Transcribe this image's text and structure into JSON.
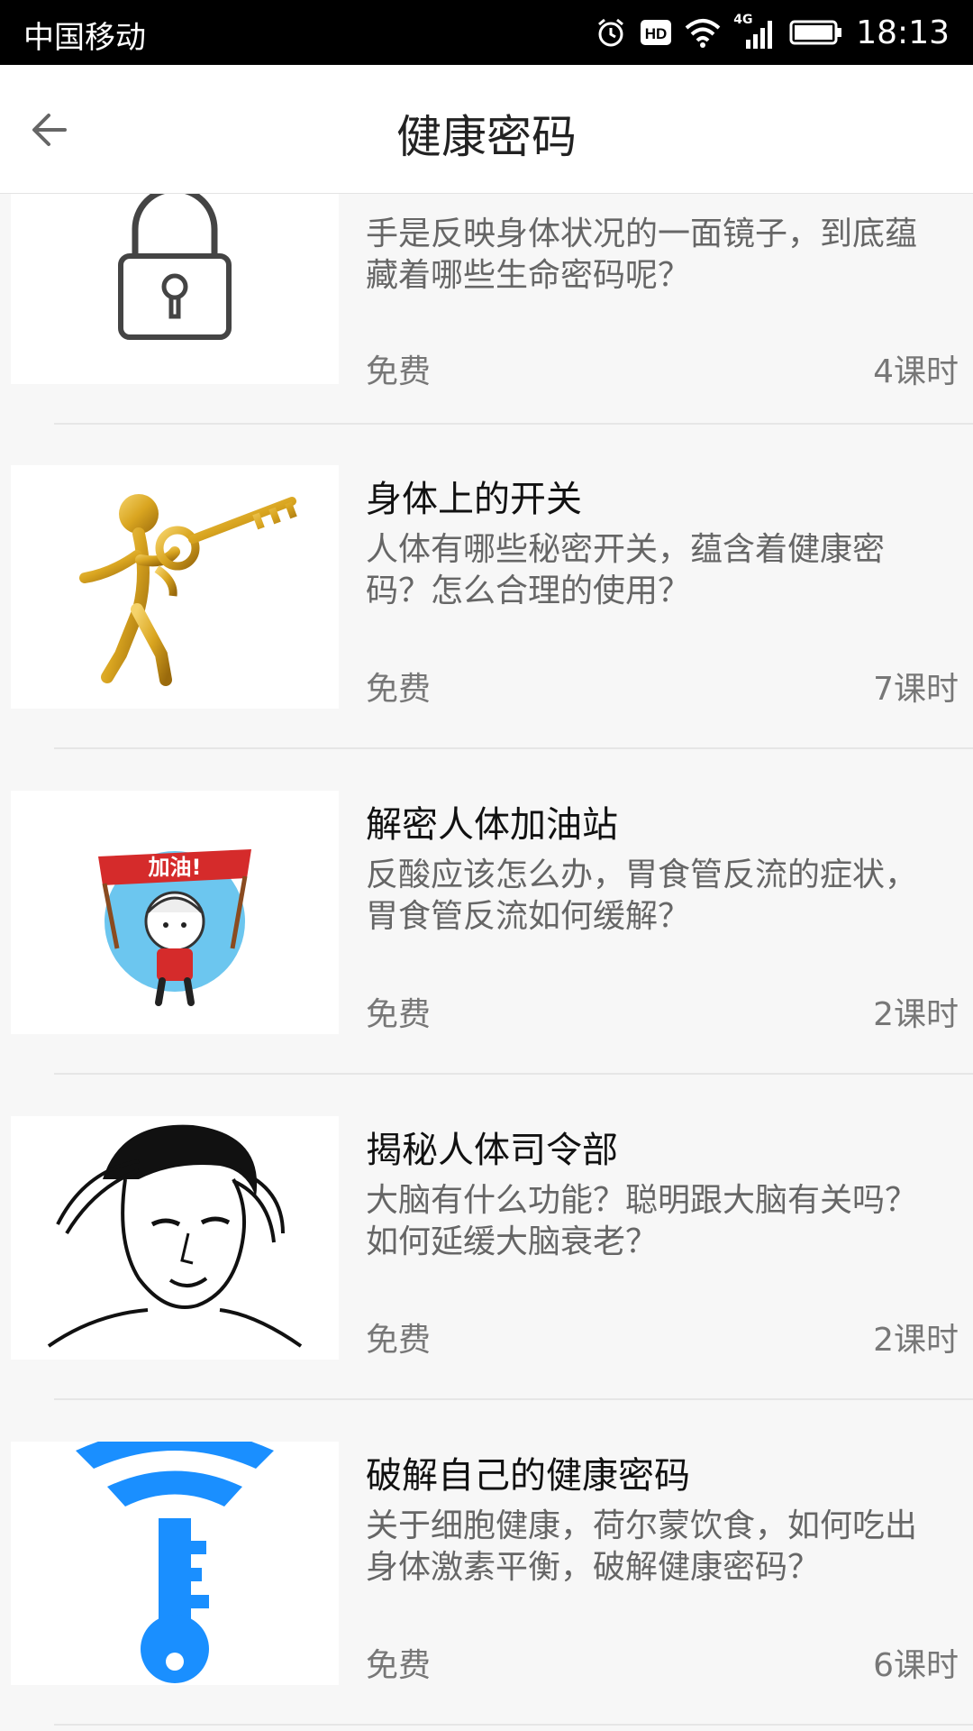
{
  "status_bar": {
    "carrier": "中国移动",
    "network": "4G",
    "time": "18:13"
  },
  "header": {
    "title": "健康密码",
    "back_icon": "arrow-left-icon"
  },
  "courses": [
    {
      "title": "",
      "desc": "手是反映身体状况的一面镜子，到底蕴藏着哪些生命密码呢？",
      "price": "免费",
      "hours": "4课时",
      "icon": "padlock-icon"
    },
    {
      "title": "身体上的开关",
      "desc": "人体有哪些秘密开关，蕴含着健康密码？怎么合理的使用？",
      "price": "免费",
      "hours": "7课时",
      "icon": "golden-figure-key-icon"
    },
    {
      "title": "解密人体加油站",
      "desc": "反酸应该怎么办，胃食管反流的症状，胃食管反流如何缓解？",
      "price": "免费",
      "hours": "2课时",
      "icon": "cartoon-cheer-icon",
      "banner_text": "加油!"
    },
    {
      "title": "揭秘人体司令部",
      "desc": "大脑有什么功能？聪明跟大脑有关吗？如何延缓大脑衰老？",
      "price": "免费",
      "hours": "2课时",
      "icon": "man-holding-head-icon"
    },
    {
      "title": "破解自己的健康密码",
      "desc": "关于细胞健康，荷尔蒙饮食，如何吃出身体激素平衡，破解健康密码？",
      "price": "免费",
      "hours": "6课时",
      "icon": "wifi-key-icon"
    }
  ],
  "colors": {
    "accent_blue": "#1a8fff",
    "gold": "#d9a520",
    "banner_red": "#d52b2b"
  }
}
